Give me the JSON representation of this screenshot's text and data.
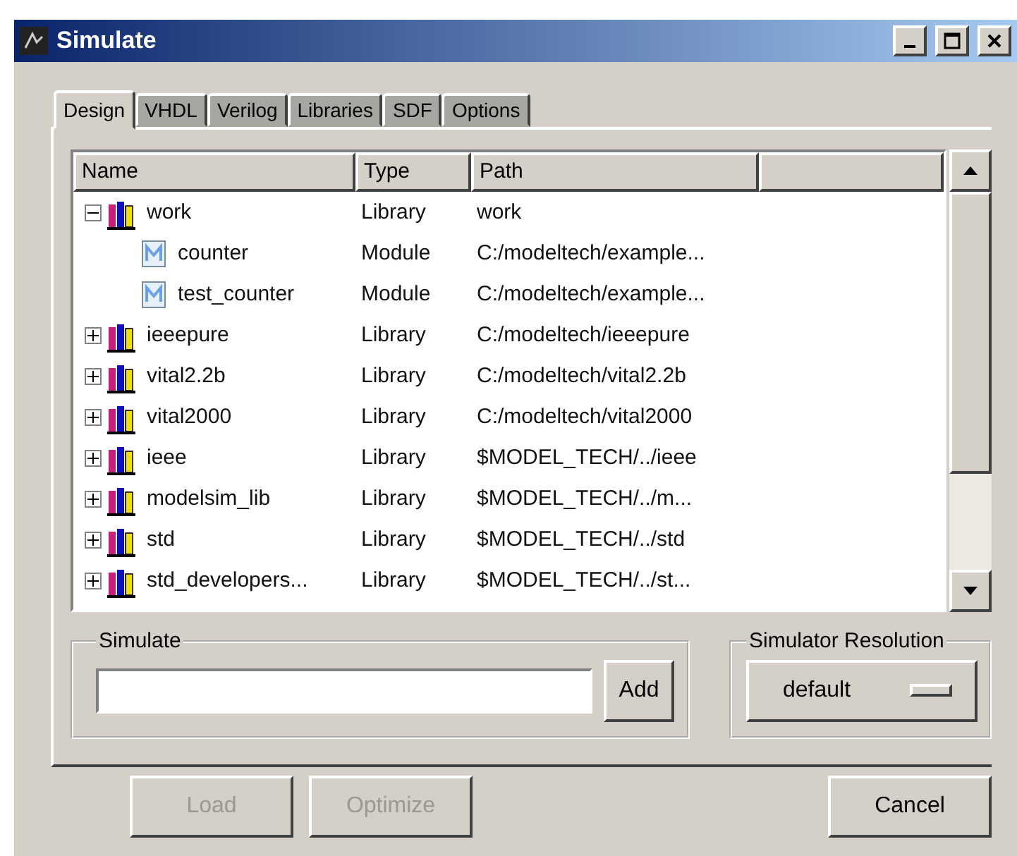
{
  "window": {
    "title": "Simulate"
  },
  "tabs": [
    {
      "label": "Design",
      "selected": true
    },
    {
      "label": "VHDL",
      "selected": false
    },
    {
      "label": "Verilog",
      "selected": false
    },
    {
      "label": "Libraries",
      "selected": false
    },
    {
      "label": "SDF",
      "selected": false
    },
    {
      "label": "Options",
      "selected": false
    }
  ],
  "table": {
    "columns": [
      "Name",
      "Type",
      "Path"
    ],
    "rows": [
      {
        "name": "work",
        "type": "Library",
        "path": "work",
        "kind": "library",
        "expanded": true,
        "children": [
          {
            "name": "counter",
            "type": "Module",
            "path": "C:/modeltech/example...",
            "kind": "module"
          },
          {
            "name": "test_counter",
            "type": "Module",
            "path": "C:/modeltech/example...",
            "kind": "module"
          }
        ]
      },
      {
        "name": "ieeepure",
        "type": "Library",
        "path": "C:/modeltech/ieeepure",
        "kind": "library",
        "expanded": false
      },
      {
        "name": "vital2.2b",
        "type": "Library",
        "path": "C:/modeltech/vital2.2b",
        "kind": "library",
        "expanded": false
      },
      {
        "name": "vital2000",
        "type": "Library",
        "path": "C:/modeltech/vital2000",
        "kind": "library",
        "expanded": false
      },
      {
        "name": "ieee",
        "type": "Library",
        "path": "$MODEL_TECH/../ieee",
        "kind": "library",
        "expanded": false
      },
      {
        "name": "modelsim_lib",
        "type": "Library",
        "path": "$MODEL_TECH/../m...",
        "kind": "library",
        "expanded": false
      },
      {
        "name": "std",
        "type": "Library",
        "path": "$MODEL_TECH/../std",
        "kind": "library",
        "expanded": false
      },
      {
        "name": "std_developers...",
        "type": "Library",
        "path": "$MODEL_TECH/../st...",
        "kind": "library",
        "expanded": false
      }
    ]
  },
  "simulate": {
    "label": "Simulate",
    "button": "Add"
  },
  "resolution": {
    "label": "Simulator Resolution",
    "value": "default"
  },
  "buttons": [
    {
      "label": "Load",
      "disabled": true
    },
    {
      "label": "Optimize",
      "disabled": true
    },
    {
      "label": "Cancel",
      "disabled": false
    }
  ]
}
